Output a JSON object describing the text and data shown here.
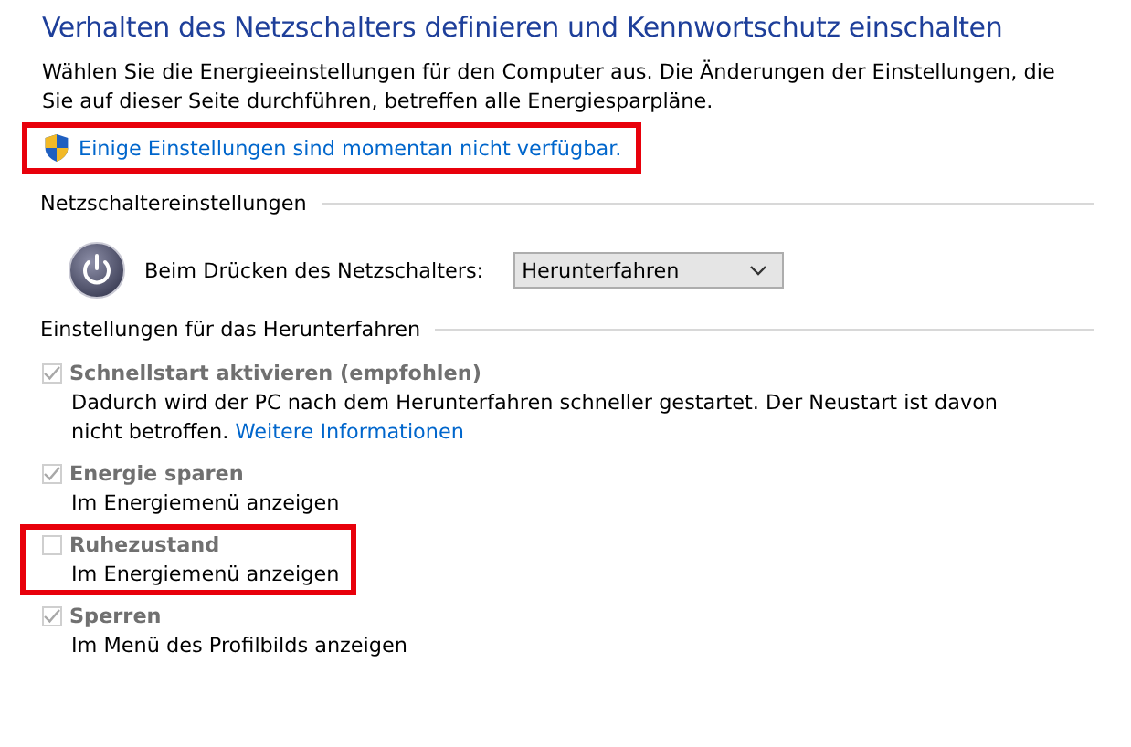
{
  "title": "Verhalten des Netzschalters definieren und Kennwortschutz einschalten",
  "intro": "Wählen Sie die Energieeinstellungen für den Computer aus. Die Änderungen der Einstellungen, die Sie auf dieser Seite durchführen, betreffen alle Energiesparpläne.",
  "admin_link": {
    "text": "Einige Einstellungen sind momentan nicht verfügbar.",
    "highlighted": true
  },
  "power_button_section": {
    "heading": "Netzschaltereinstellungen",
    "label": "Beim Drücken des Netzschalters:",
    "value": "Herunterfahren"
  },
  "shutdown_section": {
    "heading": "Einstellungen für das Herunterfahren",
    "options": [
      {
        "label": "Schnellstart aktivieren (empfohlen)",
        "description": "Dadurch wird der PC nach dem Herunterfahren schneller gestartet. Der Neustart ist davon nicht betroffen.",
        "link": "Weitere Informationen",
        "checked": true,
        "disabled": true,
        "highlighted": false
      },
      {
        "label": "Energie sparen",
        "description": "Im Energiemenü anzeigen",
        "checked": true,
        "disabled": true,
        "highlighted": false
      },
      {
        "label": "Ruhezustand",
        "description": "Im Energiemenü anzeigen",
        "checked": false,
        "disabled": true,
        "highlighted": true
      },
      {
        "label": "Sperren",
        "description": "Im Menü des Profilbilds anzeigen",
        "checked": true,
        "disabled": true,
        "highlighted": false
      }
    ]
  }
}
